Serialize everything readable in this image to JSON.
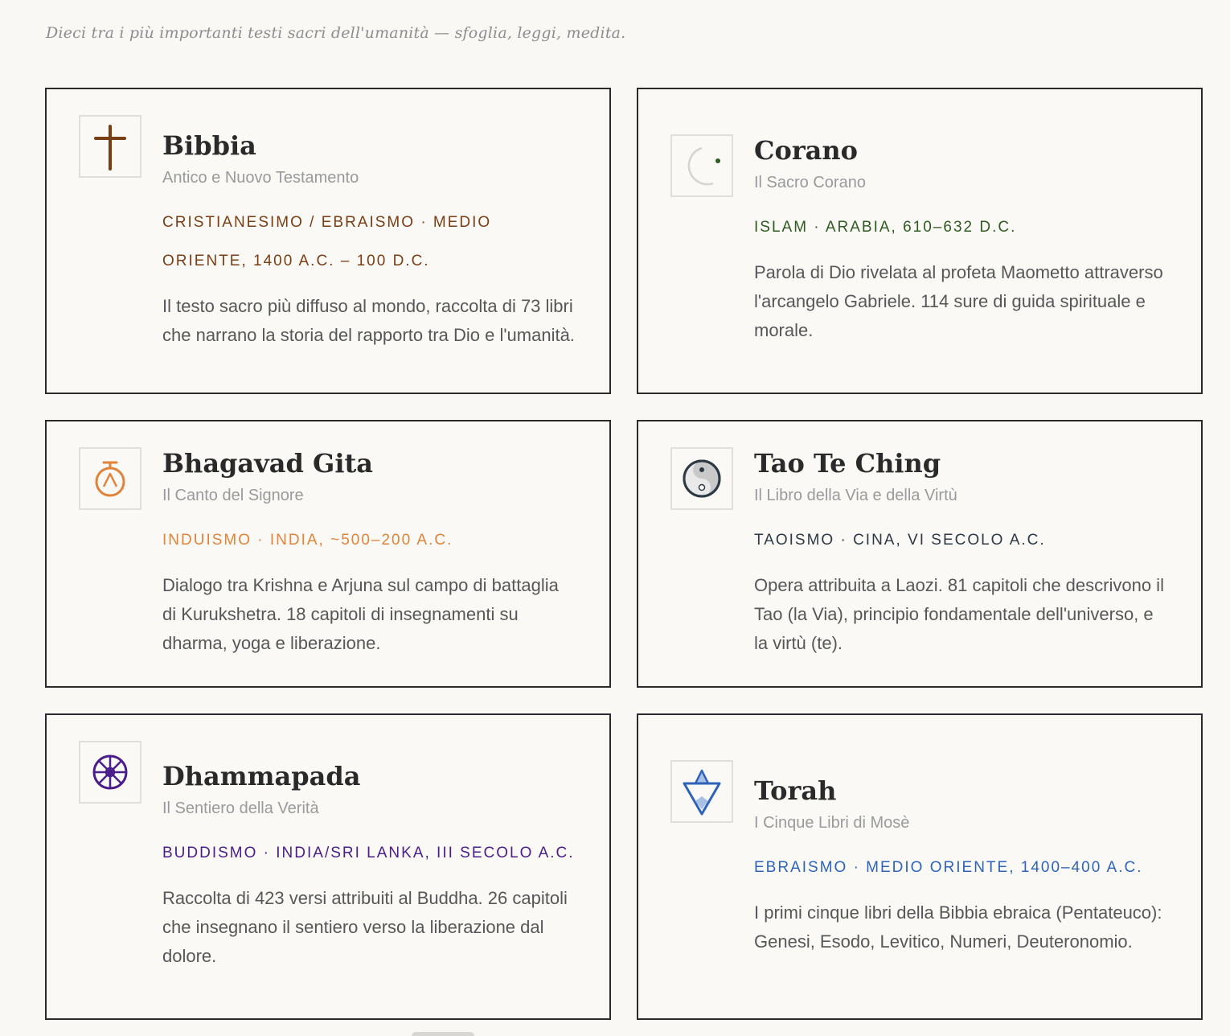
{
  "header": {
    "subtitle": "Dieci tra i più importanti testi sacri dell'umanità — sfoglia, leggi, medita."
  },
  "cards": [
    {
      "title": "Bibbia",
      "subtitle": "Antico e Nuovo Testamento",
      "meta": "CRISTIANESIMO / EBRAISMO · MEDIO ORIENTE, 1400 A.C. – 100 D.C.",
      "description": "Il testo sacro più diffuso al mondo, raccolta di 73 libri che narrano la storia del rapporto tra Dio e l'umanità.",
      "icon": "cross-icon",
      "color": "#7a3e15"
    },
    {
      "title": "Corano",
      "subtitle": "Il Sacro Corano",
      "meta": "ISLAM · ARABIA, 610–632 D.C.",
      "description": "Parola di Dio rivelata al profeta Maometto attraverso l'arcangelo Gabriele. 114 sure di guida spirituale e morale.",
      "icon": "crescent-icon",
      "color": "#2f5a21"
    },
    {
      "title": "Bhagavad Gita",
      "subtitle": "Il Canto del Signore",
      "meta": "INDUISMO · INDIA, ~500–200 A.C.",
      "description": "Dialogo tra Krishna e Arjuna sul campo di battaglia di Kurukshetra. 18 capitoli di insegnamenti su dharma, yoga e liberazione.",
      "icon": "om-icon",
      "color": "#e0843a"
    },
    {
      "title": "Tao Te Ching",
      "subtitle": "Il Libro della Via e della Virtù",
      "meta": "TAOISMO · CINA, VI SECOLO A.C.",
      "description": "Opera attribuita a Laozi. 81 capitoli che descrivono il Tao (la Via), principio fondamentale dell'universo, e la virtù (te).",
      "icon": "yin-yang-icon",
      "color": "#2d3a44"
    },
    {
      "title": "Dhammapada",
      "subtitle": "Il Sentiero della Verità",
      "meta": "BUDDISMO · INDIA/SRI LANKA, III SECOLO A.C.",
      "description": "Raccolta di 423 versi attribuiti al Buddha. 26 capitoli che insegnano il sentiero verso la liberazione dal dolore.",
      "icon": "dharma-wheel-icon",
      "color": "#4a1d8a"
    },
    {
      "title": "Torah",
      "subtitle": "I Cinque Libri di Mosè",
      "meta": "EBRAISMO · MEDIO ORIENTE, 1400–400 A.C.",
      "description": "I primi cinque libri della Bibbia ebraica (Pentateuco): Genesi, Esodo, Levitico, Numeri, Deuteronomio.",
      "icon": "star-of-david-icon",
      "color": "#2e63b8"
    }
  ]
}
